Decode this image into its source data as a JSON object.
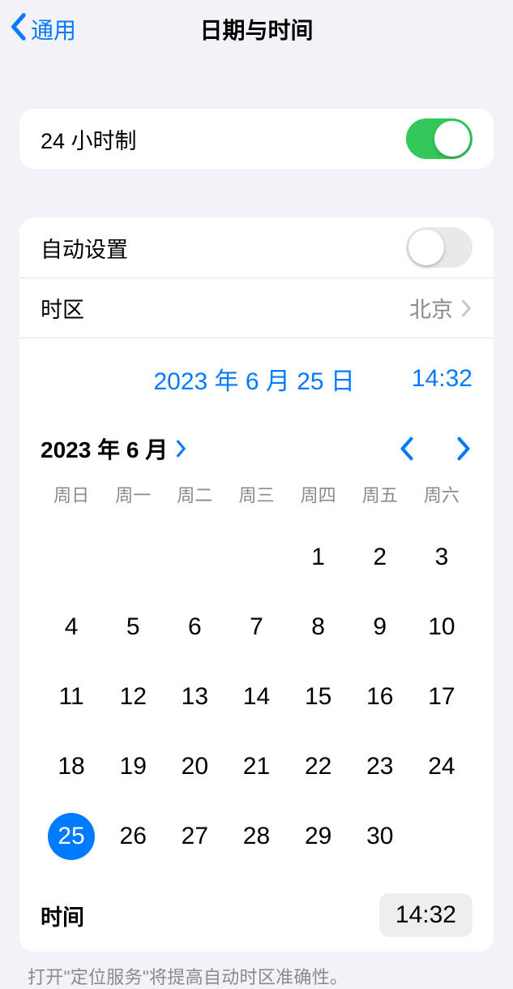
{
  "nav": {
    "back_label": "通用",
    "title": "日期与时间"
  },
  "twenty_four_hour": {
    "label": "24 小时制",
    "on": true
  },
  "auto_set": {
    "label": "自动设置",
    "on": false
  },
  "timezone": {
    "label": "时区",
    "value": "北京"
  },
  "selected": {
    "date_label": "2023 年 6 月 25 日",
    "time_label": "14:32"
  },
  "calendar": {
    "month_label": "2023 年 6 月",
    "weekdays": [
      "周日",
      "周一",
      "周二",
      "周三",
      "周四",
      "周五",
      "周六"
    ],
    "first_weekday_index": 4,
    "days_in_month": 30,
    "selected_day": 25
  },
  "time_row": {
    "label": "时间",
    "value": "14:32"
  },
  "footer": "打开\"定位服务\"将提高自动时区准确性。"
}
